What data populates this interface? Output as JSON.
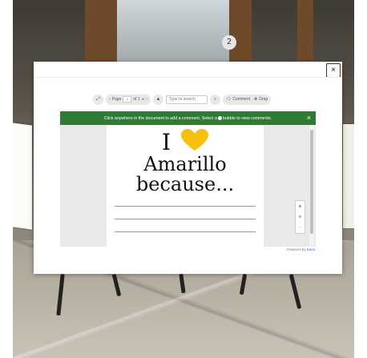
{
  "scene": {
    "marker_label": "2"
  },
  "modal": {
    "close_label": "×"
  },
  "toolbar": {
    "page_label": "Page",
    "page_value": "1",
    "page_of": "of 1",
    "search_placeholder": "Type to search",
    "comment_label": "Comment",
    "drag_label": "Drag"
  },
  "banner": {
    "text_before": "Click anywhere in the document to add a comment. Select a",
    "text_after": "bubble to view comments.",
    "close_label": "×"
  },
  "document": {
    "line1_word": "I",
    "line2": "Amarillo",
    "line3": "because...",
    "heart_color": "#f4c20d"
  },
  "footer": {
    "powered_by": "Powered by",
    "brand": "Kami"
  }
}
